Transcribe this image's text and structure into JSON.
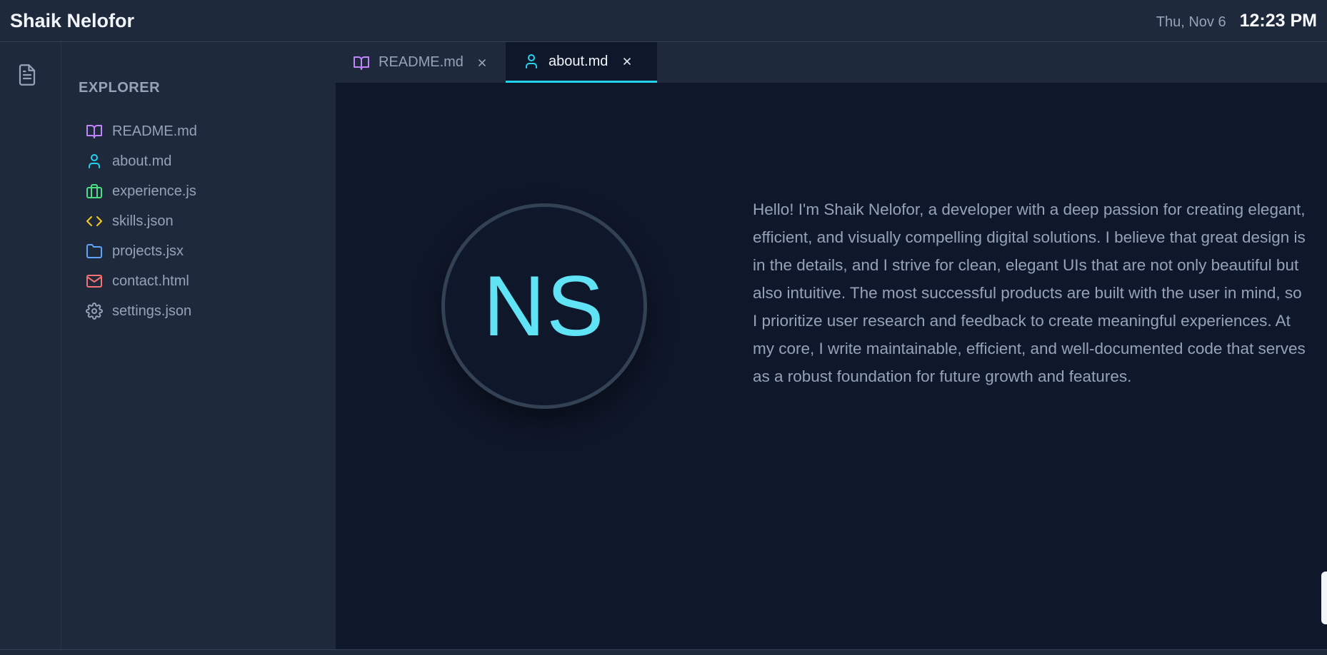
{
  "header": {
    "title": "Shaik Nelofor",
    "date": "Thu, Nov 6",
    "time": "12:23 PM"
  },
  "activity_bar": {
    "items": [
      {
        "icon": "file-text-icon"
      }
    ]
  },
  "sidebar": {
    "title": "EXPLORER",
    "files": [
      {
        "label": "README.md",
        "icon": "book-icon",
        "color": "#c084fc"
      },
      {
        "label": "about.md",
        "icon": "user-icon",
        "color": "#22d3ee"
      },
      {
        "label": "experience.js",
        "icon": "briefcase-icon",
        "color": "#4ade80"
      },
      {
        "label": "skills.json",
        "icon": "code-icon",
        "color": "#facc15"
      },
      {
        "label": "projects.jsx",
        "icon": "folder-icon",
        "color": "#60a5fa"
      },
      {
        "label": "contact.html",
        "icon": "mail-icon",
        "color": "#f87171"
      },
      {
        "label": "settings.json",
        "icon": "gear-icon",
        "color": "#94a3b8"
      }
    ]
  },
  "tabs": [
    {
      "label": "README.md",
      "icon": "book-icon",
      "color": "#c084fc",
      "active": false
    },
    {
      "label": "about.md",
      "icon": "user-icon",
      "color": "#22d3ee",
      "active": true
    }
  ],
  "about": {
    "initials": "NS",
    "text": "Hello! I'm Shaik Nelofor, a developer with a deep passion for creating elegant, efficient, and visually compelling digital solutions. I believe that great design is in the details, and I strive for clean, elegant UIs that are not only beautiful but also intuitive. The most successful products are built with the user in mind, so I prioritize user research and feedback to create meaningful experiences. At my core, I write maintainable, efficient, and well-documented code that serves as a robust foundation for future growth and features."
  },
  "colors": {
    "accent": "#22d3ee",
    "background": "#0f172a",
    "panel": "#1e293b"
  }
}
